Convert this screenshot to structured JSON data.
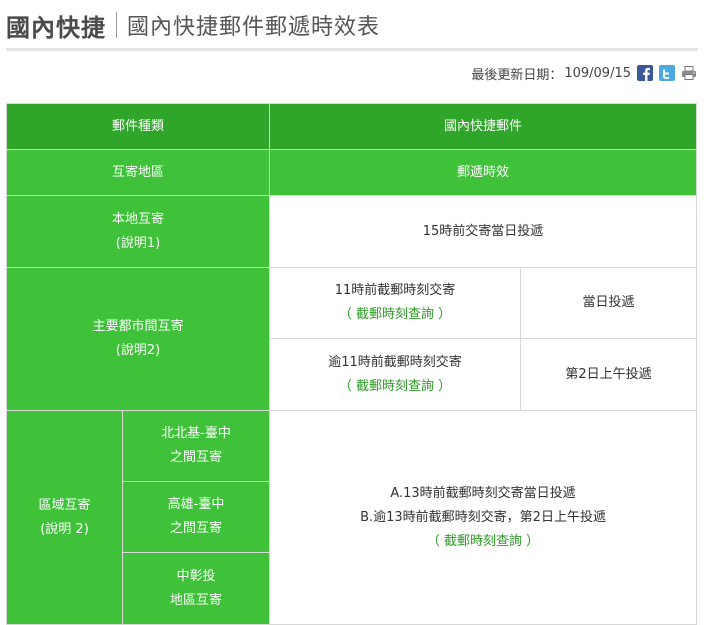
{
  "header": {
    "title": "國內快捷",
    "subtitle": "國內快捷郵件郵遞時效表",
    "last_updated_label": "最後更新日期：",
    "last_updated_value": "109/09/15"
  },
  "icons": [
    "facebook-icon",
    "twitter-icon",
    "print-icon"
  ],
  "colors": {
    "header_dark_green": "#2fa52a",
    "header_green": "#3fc23a",
    "link_green": "#2e9a27"
  },
  "table": {
    "col_type": "郵件種類",
    "col_service": "國內快捷郵件",
    "col_region": "互寄地區",
    "col_time": "郵遞時效",
    "local": {
      "label": "本地互寄",
      "note": "(說明1)",
      "time": "15時前交寄當日投遞"
    },
    "major_city": {
      "label": "主要都市間互寄",
      "note": "(說明2)",
      "row1_cond": "11時前截郵時刻交寄",
      "row1_link": "（ 截郵時刻查詢 ）",
      "row1_time": "當日投遞",
      "row2_cond": "逾11時前截郵時刻交寄",
      "row2_link": "（ 截郵時刻查詢 ）",
      "row2_time": "第2日上午投遞"
    },
    "regional": {
      "label": "區域互寄",
      "note": "(說明 2)",
      "sub1_line1": "北北基-臺中",
      "sub1_line2": "之間互寄",
      "sub2_line1": "高雄-臺中",
      "sub2_line2": "之間互寄",
      "sub3_line1": "中彰投",
      "sub3_line2": "地區互寄",
      "time_a": "A.13時前截郵時刻交寄當日投遞",
      "time_b": "B.逾13時前截郵時刻交寄，第2日上午投遞",
      "link": "（ 截郵時刻查詢 ）"
    }
  }
}
